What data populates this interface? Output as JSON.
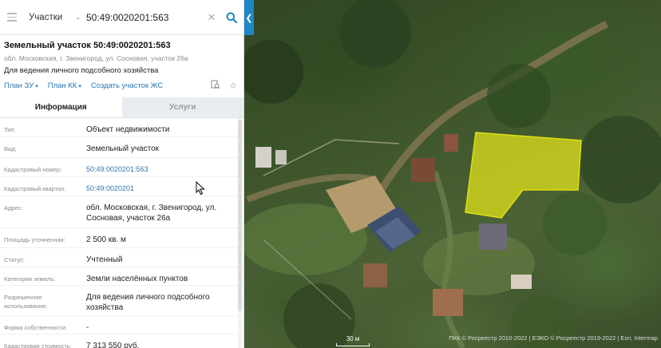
{
  "search": {
    "layer": "Участки",
    "query": "50:49:0020201:563"
  },
  "object": {
    "title": "Земельный участок 50:49:0020201:563",
    "address": "обл. Московская, г. Звенигород, ул. Сосновая, участок 26а",
    "purpose": "Для ведения личного подсобного хозяйства"
  },
  "links": {
    "plan_zu": "План ЗУ",
    "plan_kk": "План КК",
    "create_plan": "Создать участок ЖС"
  },
  "tabs": [
    {
      "label": "Информация",
      "active": true
    },
    {
      "label": "Услуги",
      "active": false
    }
  ],
  "info_rows": [
    {
      "label": "Тип:",
      "value": "Объект недвижимости"
    },
    {
      "label": "Вид:",
      "value": "Земельный участок"
    },
    {
      "label": "Кадастровый номер:",
      "value": "50:49:0020201:563"
    },
    {
      "label": "Кадастровый квартал:",
      "value": "50:49:0020201"
    },
    {
      "label": "Адрес:",
      "value": "обл. Московская, г. Звенигород, ул. Сосновая, участок 26а"
    },
    {
      "label": "Площадь уточненная:",
      "value": "2 500 кв. м"
    },
    {
      "label": "Статус:",
      "value": "Учтенный"
    },
    {
      "label": "Категория земель:",
      "value": "Земли населённых пунктов"
    },
    {
      "label": "Разрешенное использование:",
      "value": "Для ведения личного подсобного хозяйства"
    },
    {
      "label": "Форма собственности:",
      "value": "-"
    },
    {
      "label": "Кадастровая стоимость:",
      "value": "7 313 550 руб."
    }
  ],
  "map": {
    "scale_label": "30 м",
    "copyright": "ПКК © Росреестр 2010-2022 | ЕЭКО © Росреестр 2019-2022 | Esri, Intermap",
    "parcel_color": "#e6e619"
  },
  "colors": {
    "accent": "#1e88c7",
    "link": "#2a76b5"
  }
}
